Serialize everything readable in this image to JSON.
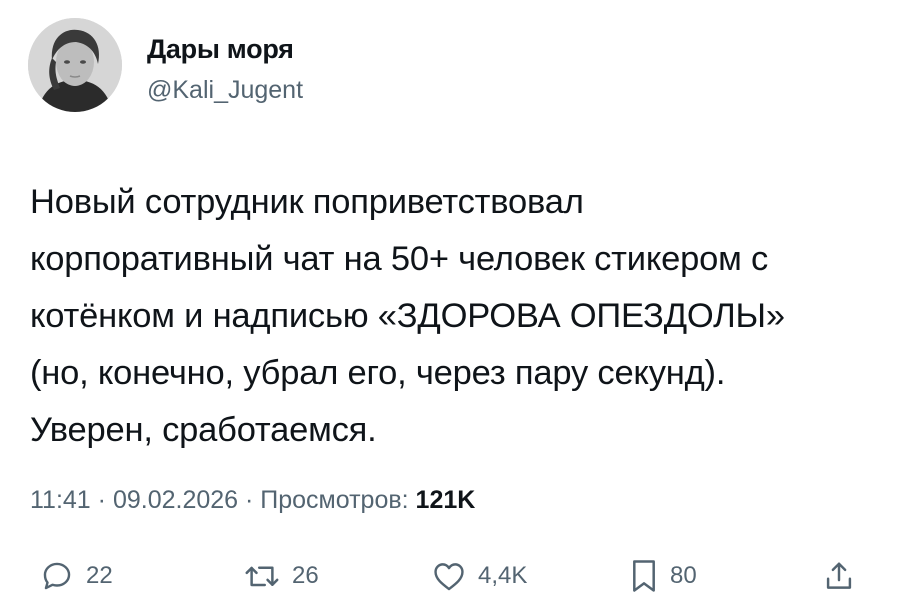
{
  "tweet": {
    "author": {
      "display_name": "Дары моря",
      "handle": "@Kali_Jugent"
    },
    "text_lines": [
      "Новый сотрудник поприветствовал",
      "корпоративный чат на 50+ человек стикером с",
      "котёнком и надписью «ЗДОРОВА ОПЕЗДОЛЫ»",
      "(но, конечно, убрал его, через пару секунд).",
      "Уверен, сработаемся."
    ],
    "meta": {
      "time": "11:41",
      "separator": " · ",
      "date": "09.02.2026",
      "views_label": "Просмотров:",
      "views_count": "121K"
    },
    "actions": {
      "replies": "22",
      "retweets": "26",
      "likes": "4,4K",
      "bookmarks": "80"
    }
  },
  "icons": {
    "reply": "reply-icon",
    "retweet": "retweet-icon",
    "like": "heart-icon",
    "bookmark": "bookmark-icon",
    "share": "share-icon"
  },
  "colors": {
    "text_primary": "#0f1419",
    "text_secondary": "#536471",
    "background": "#ffffff"
  }
}
